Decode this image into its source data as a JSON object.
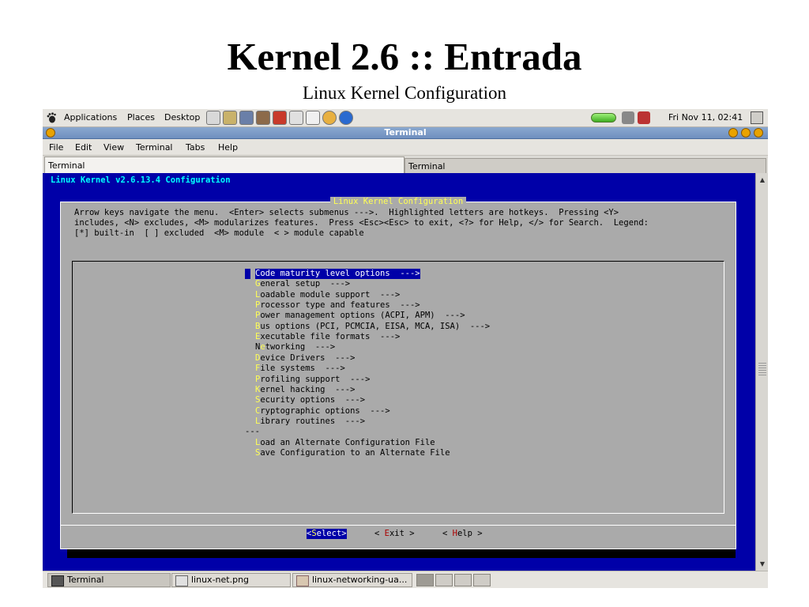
{
  "slide": {
    "title": "Kernel 2.6 :: Entrada",
    "subtitle": "Linux Kernel Configuration"
  },
  "top_panel": {
    "menus": [
      "Applications",
      "Places",
      "Desktop"
    ],
    "clock": "Fri Nov 11, 02:41",
    "launcher_icons": [
      "text-editor-icon",
      "notes-icon",
      "terminal-icon",
      "paint-icon",
      "mail-icon",
      "image-viewer-icon",
      "document-icon",
      "help-icon",
      "web-browser-icon"
    ]
  },
  "window": {
    "title": "Terminal",
    "menu": [
      "File",
      "Edit",
      "View",
      "Terminal",
      "Tabs",
      "Help"
    ],
    "tabs": [
      "Terminal",
      "Terminal"
    ]
  },
  "terminal": {
    "header": "Linux Kernel v2.6.13.4 Configuration",
    "dialog_title": "Linux Kernel Configuration",
    "help_lines": [
      "Arrow keys navigate the menu.  <Enter> selects submenus --->.  Highlighted letters are hotkeys.  Pressing <Y>",
      "includes, <N> excludes, <M> modularizes features.  Press <Esc><Esc> to exit, <?> for Help, </> for Search.  Legend:",
      "[*] built-in  [ ] excluded  <M> module  < > module capable"
    ],
    "menu_items": [
      {
        "hotkey": "C",
        "rest": "ode maturity level options  --->",
        "selected": true
      },
      {
        "hotkey": "G",
        "rest": "eneral setup  --->"
      },
      {
        "hotkey": "L",
        "rest": "oadable module support  --->"
      },
      {
        "hotkey": "P",
        "rest": "rocessor type and features  --->"
      },
      {
        "hotkey": "P",
        "rest": "ower management options (ACPI, APM)  --->"
      },
      {
        "hotkey": "B",
        "rest": "us options (PCI, PCMCIA, EISA, MCA, ISA)  --->"
      },
      {
        "hotkey": "E",
        "rest": "xecutable file formats  --->"
      },
      {
        "pre": "N",
        "hotkey": "e",
        "rest": "tworking  --->"
      },
      {
        "hotkey": "D",
        "rest": "evice Drivers  --->"
      },
      {
        "hotkey": "F",
        "rest": "ile systems  --->"
      },
      {
        "hotkey": "P",
        "rest": "rofiling support  --->"
      },
      {
        "hotkey": "K",
        "rest": "ernel hacking  --->"
      },
      {
        "hotkey": "S",
        "rest": "ecurity options  --->"
      },
      {
        "hotkey": "C",
        "rest": "ryptographic options  --->"
      },
      {
        "hotkey": "L",
        "rest": "ibrary routines  --->"
      }
    ],
    "separator": "---",
    "file_items": [
      {
        "hotkey": "L",
        "rest": "oad an Alternate Configuration File"
      },
      {
        "hotkey": "S",
        "rest": "ave Configuration to an Alternate File"
      }
    ],
    "buttons": {
      "select": {
        "open": "<",
        "hotkey": "S",
        "rest": "elect",
        "close": ">"
      },
      "exit": {
        "open": "< ",
        "hotkey": "E",
        "rest": "xit",
        "close": " >"
      },
      "help": {
        "open": "< ",
        "hotkey": "H",
        "rest": "elp",
        "close": " >"
      }
    }
  },
  "taskbar": {
    "tasks": [
      "Terminal",
      "linux-net.png",
      "linux-networking-ua..."
    ]
  },
  "colors": {
    "terminal_bg": "#0000a8",
    "dialog_bg": "#aaaaaa",
    "hotkey": "#ffff55",
    "header_cyan": "#00ffff"
  }
}
